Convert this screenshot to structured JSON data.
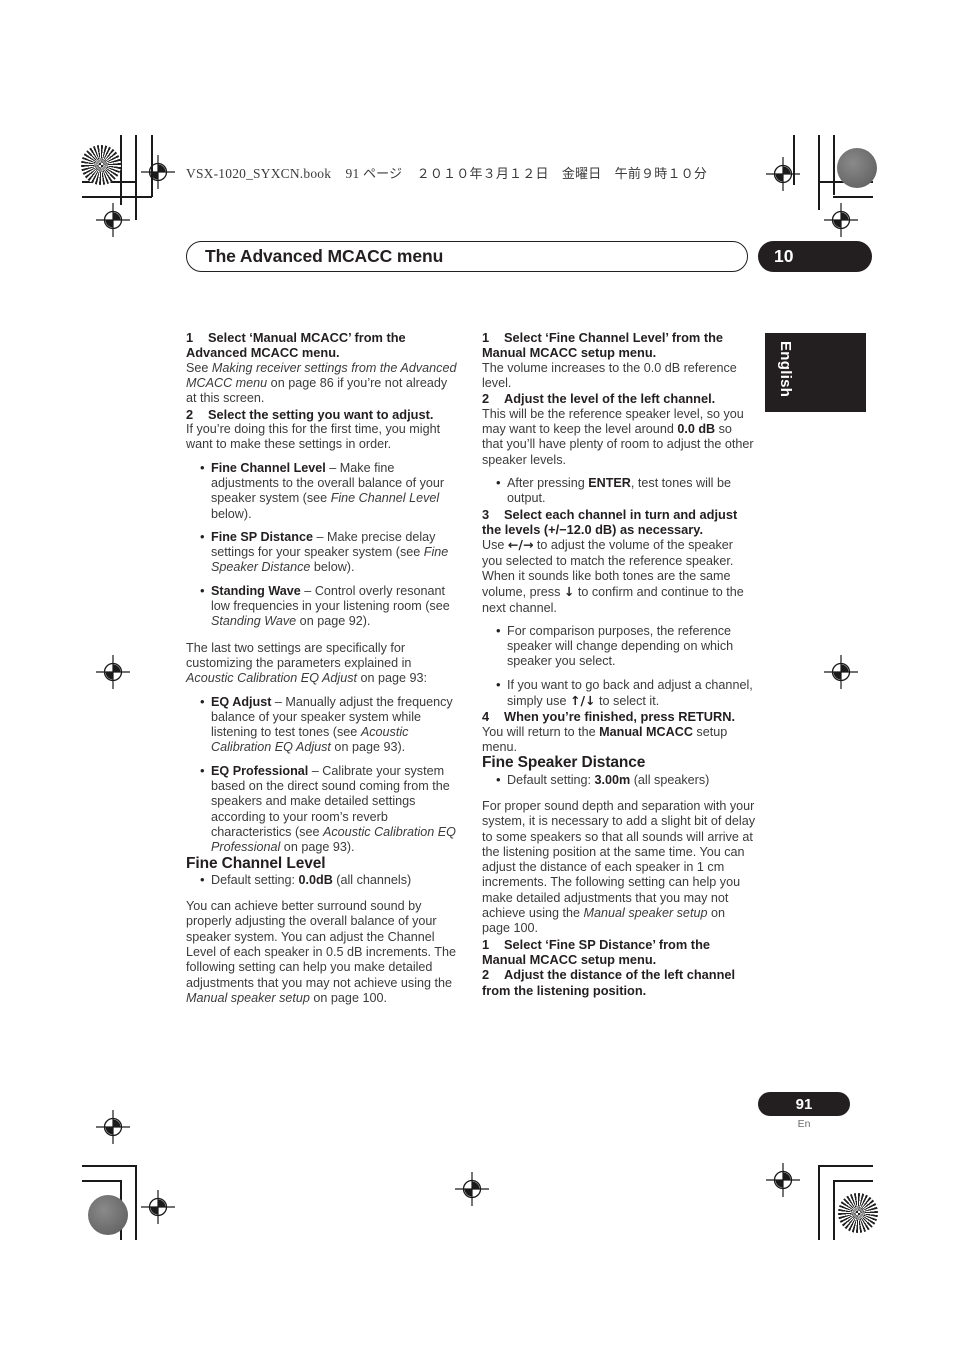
{
  "header": {
    "book_info": "VSX-1020_SYXCN.book",
    "book_page": "91",
    "book_page_unit": "ページ",
    "book_date": "２０１０年３月１２日　金曜日　午前９時１０分"
  },
  "chapter": {
    "title": "The Advanced MCACC menu",
    "number": "10"
  },
  "side_tab": {
    "language": "English"
  },
  "footer": {
    "page_number": "91",
    "page_lang": "En"
  },
  "left_column": {
    "step1": {
      "number": "1",
      "heading": "Select ‘Manual MCACC’ from the Advanced MCACC menu.",
      "body_a": "See ",
      "body_i": "Making receiver settings from the Advanced MCACC menu",
      "body_b": " on page 86 if you’re not already at this screen."
    },
    "step2": {
      "number": "2",
      "heading": "Select the setting you want to adjust.",
      "body": "If you’re doing this for the first time, you might want to make these settings in order."
    },
    "bullets": [
      {
        "term": "Fine Channel Level",
        "text_a": " – Make fine adjustments to the overall balance of your speaker system (see ",
        "italic": "Fine Channel Level",
        "text_b": " below)."
      },
      {
        "term": "Fine SP Distance",
        "text_a": " – Make precise delay settings for your speaker system (see ",
        "italic": "Fine Speaker Distance",
        "text_b": " below)."
      },
      {
        "term": "Standing Wave",
        "text_a": " – Control overly resonant low frequencies in your listening room (see ",
        "italic": "Standing Wave",
        "text_b": " on page 92)."
      }
    ],
    "last_two": {
      "text_a": "The last two settings are specifically for customizing the parameters explained in ",
      "italic": "Acoustic Calibration EQ Adjust",
      "text_b": " on page 93:"
    },
    "bullets2": [
      {
        "term": "EQ Adjust",
        "text_a": " – Manually adjust the frequency balance of your speaker system while listening to test tones (see ",
        "italic": "Acoustic Calibration EQ Adjust",
        "text_b": " on page 93)."
      },
      {
        "term": "EQ Professional",
        "text_a": " – Calibrate your system based on the direct sound coming from the speakers and make detailed settings according to your room’s reverb characteristics (see ",
        "italic": "Acoustic Calibration EQ Professional",
        "text_b": " on page 93)."
      }
    ],
    "section": {
      "heading": "Fine Channel Level",
      "default_label": "Default setting: ",
      "default_value": "0.0dB",
      "default_suffix": " (all channels)",
      "body_a": "You can achieve better surround sound by properly adjusting the overall balance of your speaker system. You can adjust the Channel Level of each speaker in 0.5 dB increments. The following setting can help you make detailed adjustments that you may not achieve using the ",
      "body_i": "Manual speaker setup",
      "body_b": " on page 100."
    }
  },
  "right_column": {
    "step1": {
      "number": "1",
      "heading": "Select ‘Fine Channel Level’ from the Manual MCACC setup menu.",
      "body": "The volume increases to the 0.0 dB reference level."
    },
    "step2": {
      "number": "2",
      "heading": "Adjust the level of the left channel.",
      "body_a": "This will be the reference speaker level, so you may want to keep the level around ",
      "body_bold": "0.0 dB",
      "body_b": " so that you’ll have plenty of room to adjust the other speaker levels.",
      "bullet_a": "After pressing ",
      "bullet_bold": "ENTER",
      "bullet_b": ", test tones will be output."
    },
    "step3": {
      "number": "3",
      "heading": "Select each channel in turn and adjust the levels (+/−12.0 dB) as necessary.",
      "body_a": "Use ",
      "arrow_lr": "←/→",
      "body_b": " to adjust the volume of the speaker you selected to match the reference speaker. When it sounds like both tones are the same volume, press ",
      "arrow_down": "↓",
      "body_c": " to confirm and continue to the next channel.",
      "bullets": [
        "For comparison purposes, the reference speaker will change depending on which speaker you select."
      ],
      "bullet2_a": "If you want to go back and adjust a channel, simply use ",
      "bullet2_arrows": "↑/↓",
      "bullet2_b": " to select it."
    },
    "step4": {
      "number": "4",
      "heading": "When you’re finished, press RETURN.",
      "body_a": "You will return to the ",
      "body_bold": "Manual MCACC",
      "body_b": " setup menu."
    },
    "section": {
      "heading": "Fine Speaker Distance",
      "default_label": "Default setting: ",
      "default_value": "3.00m",
      "default_suffix": " (all speakers)",
      "body_a": "For proper sound depth and separation with your system, it is necessary to add a slight bit of delay to some speakers so that all sounds will arrive at the listening position at the same time. You can adjust the distance of each speaker in 1 cm increments. The following setting can help you make detailed adjustments that you may not achieve using the ",
      "body_i": "Manual speaker setup",
      "body_b": " on page 100."
    },
    "step5": {
      "number": "1",
      "heading": "Select ‘Fine SP Distance’ from the Manual MCACC setup menu."
    },
    "step6": {
      "number": "2",
      "heading": "Adjust the distance of the left channel from the listening position."
    }
  }
}
